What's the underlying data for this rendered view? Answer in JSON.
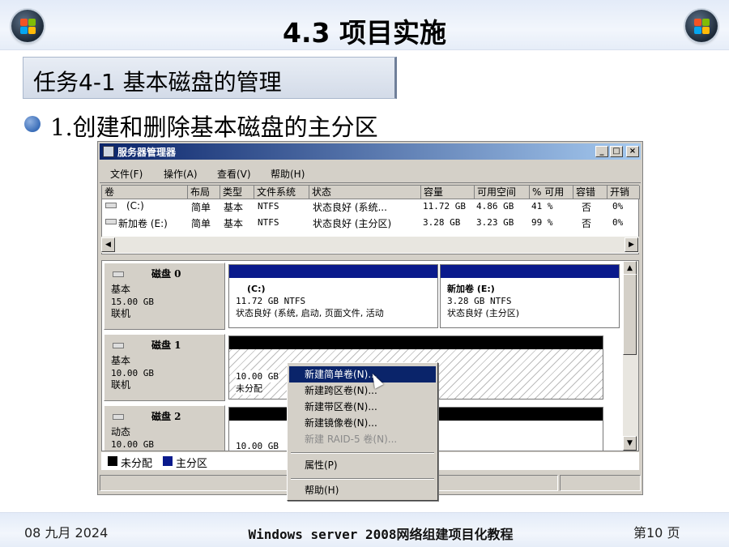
{
  "slide": {
    "title": "4.3  项目实施",
    "task": "任务4-1  基本磁盘的管理",
    "bullet": "1.创建和删除基本磁盘的主分区",
    "footer_date": "08 九月 2024",
    "footer_title": "Windows server 2008网络组建项目化教程",
    "footer_page": "第10 页"
  },
  "window": {
    "title": "服务器管理器",
    "buttons": {
      "minimize": "_",
      "maximize": "□",
      "close": "×"
    },
    "menu": [
      "文件(F)",
      "操作(A)",
      "查看(V)",
      "帮助(H)"
    ],
    "columns": [
      "卷",
      "布局",
      "类型",
      "文件系统",
      "状态",
      "容量",
      "可用空间",
      "% 可用",
      "容错",
      "开销"
    ],
    "rows": [
      [
        "(C:)",
        "简单",
        "基本",
        "NTFS",
        "状态良好 (系统...",
        "11.72 GB",
        "4.86 GB",
        "41 %",
        "否",
        "0%"
      ],
      [
        "新加卷 (E:)",
        "简单",
        "基本",
        "NTFS",
        "状态良好 (主分区)",
        "3.28 GB",
        "3.23 GB",
        "99 %",
        "否",
        "0%"
      ]
    ],
    "disks": [
      {
        "name": "磁盘 0",
        "type": "基本",
        "size": "15.00 GB",
        "state": "联机",
        "partitions": [
          {
            "title": "(C:)",
            "size": "11.72 GB NTFS",
            "status": "状态良好 (系统, 启动, 页面文件, 活动"
          },
          {
            "title": "新加卷  (E:)",
            "size": "3.28 GB NTFS",
            "status": "状态良好 (主分区)"
          }
        ]
      },
      {
        "name": "磁盘 1",
        "type": "基本",
        "size": "10.00 GB",
        "state": "联机",
        "partitions": [
          {
            "size": "10.00 GB",
            "status": "未分配"
          }
        ]
      },
      {
        "name": "磁盘 2",
        "type": "动态",
        "size": "10.00 GB",
        "state": "",
        "partitions": [
          {
            "size": "10.00 GB",
            "status": ""
          }
        ]
      }
    ],
    "legend": [
      "未分配",
      "主分区"
    ],
    "legend_colors": {
      "unallocated": "#000000",
      "primary": "#0a1a8c"
    }
  },
  "context_menu": {
    "items": [
      "新建简单卷(N)...",
      "新建跨区卷(N)...",
      "新建带区卷(N)...",
      "新建镜像卷(N)...",
      "新建 RAID-5 卷(N)..."
    ],
    "properties": "属性(P)",
    "help": "帮助(H)"
  }
}
